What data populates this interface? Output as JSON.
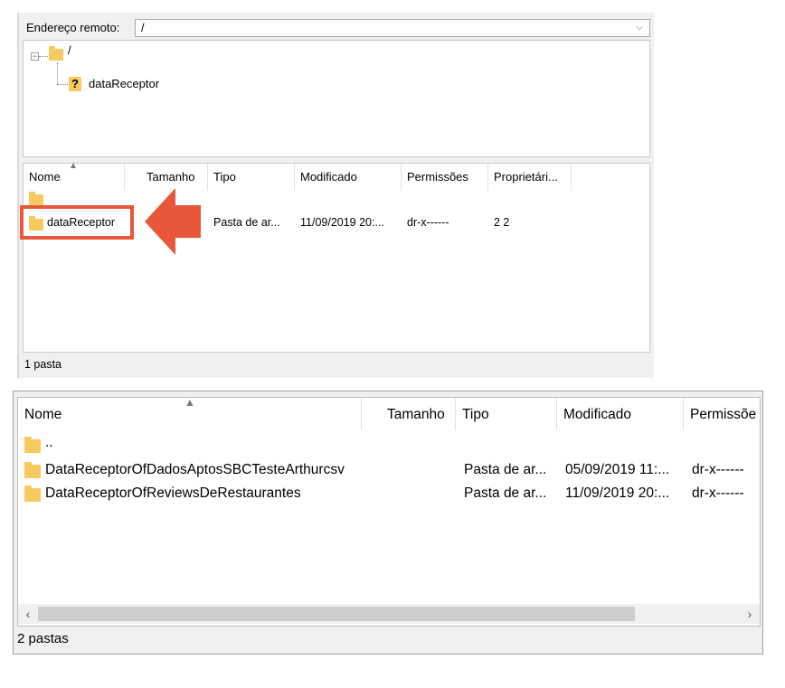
{
  "remote": {
    "label": "Endereço remoto:",
    "value": "/"
  },
  "tree": {
    "root_label": "/",
    "child_label": "dataReceptor",
    "expander": "−",
    "child_icon": "?"
  },
  "list1": {
    "columns": [
      "Nome",
      "Tamanho",
      "Tipo",
      "Modificado",
      "Permissões",
      "Proprietári..."
    ],
    "rows": [
      {
        "name": "",
        "size": "",
        "type": "",
        "modified": "",
        "perms": "",
        "owner": ""
      },
      {
        "name": "dataReceptor",
        "size": "",
        "type": "Pasta de ar...",
        "modified": "11/09/2019 20:...",
        "perms": "dr-x------",
        "owner": "2 2"
      }
    ],
    "status": "1 pasta"
  },
  "list2": {
    "columns": [
      "Nome",
      "Tamanho",
      "Tipo",
      "Modificado",
      "Permissõe"
    ],
    "rows": [
      {
        "name": "..",
        "type": "",
        "modified": "",
        "perms": ""
      },
      {
        "name": "DataReceptorOfDadosAptosSBCTesteArthurcsv",
        "type": "Pasta de ar...",
        "modified": "05/09/2019 11:...",
        "perms": "dr-x------"
      },
      {
        "name": "DataReceptorOfReviewsDeRestaurantes",
        "type": "Pasta de ar...",
        "modified": "11/09/2019 20:...",
        "perms": "dr-x------"
      }
    ],
    "status": "2 pastas"
  },
  "colors": {
    "highlight": "#e8573a",
    "folder": "#f7ca5f"
  }
}
